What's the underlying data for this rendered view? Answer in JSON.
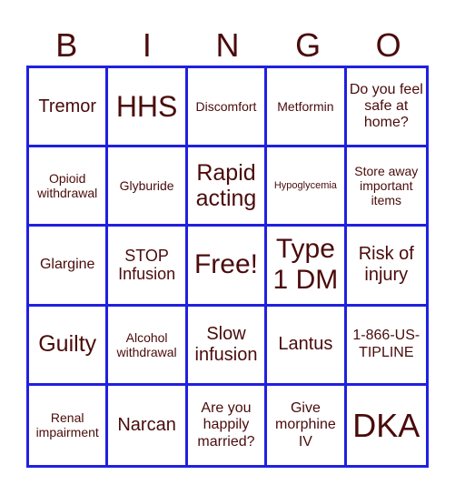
{
  "header": [
    "B",
    "I",
    "N",
    "G",
    "O"
  ],
  "colors": {
    "grid": "#2020e0",
    "text": "#4a0b0b",
    "background": "#ffffff"
  },
  "cells": [
    "Tremor",
    "HHS",
    "Discomfort",
    "Metformin",
    "Do you feel safe at home?",
    "Opioid withdrawal",
    "Glyburide",
    "Rapid acting",
    "Hypoglycemia",
    "Store away important items",
    "Glargine",
    "STOP Infusion",
    "Free!",
    "Type 1 DM",
    "Risk of injury",
    "Guilty",
    "Alcohol withdrawal",
    "Slow infusion",
    "Lantus",
    "1-866-US-TIPLINE",
    "Renal impairment",
    "Narcan",
    "Are you happily married?",
    "Give morphine IV",
    "DKA"
  ]
}
